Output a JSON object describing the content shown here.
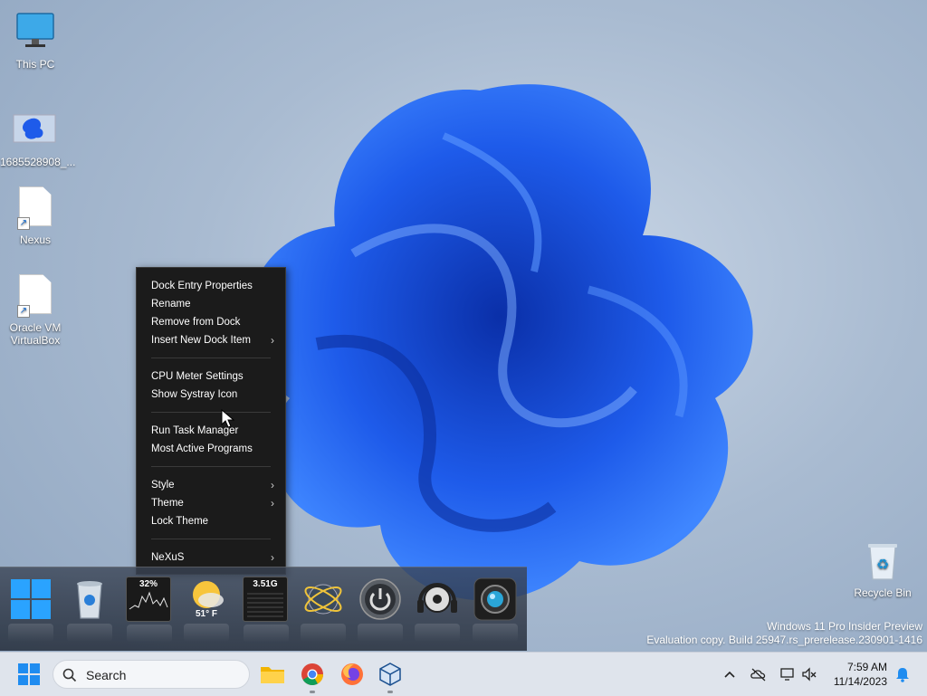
{
  "desktop_icons": {
    "this_pc": "This PC",
    "image_file": "1685528908_...",
    "nexus": "Nexus",
    "virtualbox_line1": "Oracle VM",
    "virtualbox_line2": "VirtualBox",
    "recycle_bin": "Recycle Bin"
  },
  "context_menu": {
    "items": [
      {
        "label": "Dock Entry Properties",
        "submenu": false
      },
      {
        "label": "Rename",
        "submenu": false
      },
      {
        "label": "Remove from Dock",
        "submenu": false
      },
      {
        "label": "Insert New Dock Item",
        "submenu": true
      },
      {
        "label": "CPU Meter Settings",
        "submenu": false
      },
      {
        "label": "Show Systray Icon",
        "submenu": false
      },
      {
        "label": "Run Task Manager",
        "submenu": false
      },
      {
        "label": "Most Active Programs",
        "submenu": false
      },
      {
        "label": "Style",
        "submenu": true
      },
      {
        "label": "Theme",
        "submenu": true
      },
      {
        "label": "Lock Theme",
        "submenu": false
      },
      {
        "label": "NeXuS",
        "submenu": true
      }
    ],
    "arrow_glyph": "›"
  },
  "dock": {
    "cpu_meter": "32%",
    "weather_temp": "51° F",
    "memory_meter": "3.51G",
    "icons": [
      "windows-logo-icon",
      "recycle-bin-icon",
      "cpu-meter-icon",
      "weather-icon",
      "memory-meter-icon",
      "globe-icon",
      "power-icon",
      "headphones-icon",
      "camera-icon"
    ]
  },
  "watermark": {
    "line1": "Windows 11 Pro Insider Preview",
    "line2": "Evaluation copy. Build 25947.rs_prerelease.230901-1416"
  },
  "taskbar": {
    "search_placeholder": "Search",
    "time": "7:59 AM",
    "date": "11/14/2023"
  },
  "colors": {
    "accent": "#1a6fd1",
    "menu_bg": "#1b1b1b",
    "taskbar_bg": "#dfe4ec"
  }
}
